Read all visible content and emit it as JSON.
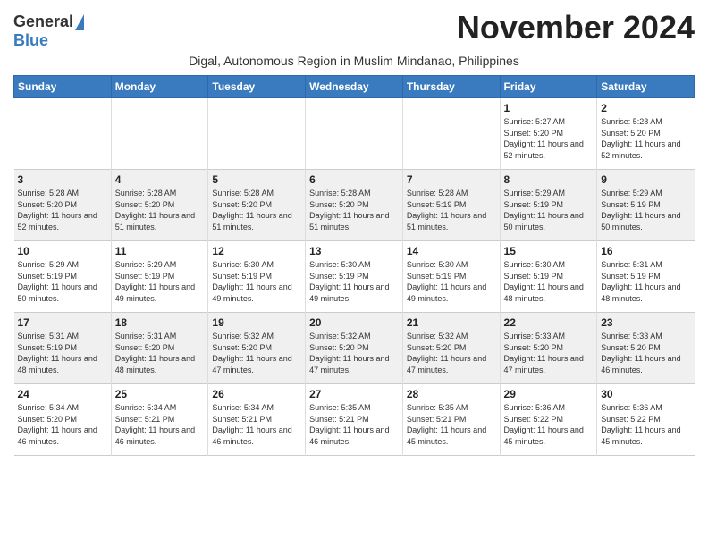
{
  "header": {
    "logo_general": "General",
    "logo_blue": "Blue",
    "month_title": "November 2024",
    "subtitle": "Digal, Autonomous Region in Muslim Mindanao, Philippines"
  },
  "days_of_week": [
    "Sunday",
    "Monday",
    "Tuesday",
    "Wednesday",
    "Thursday",
    "Friday",
    "Saturday"
  ],
  "weeks": [
    [
      {
        "day": "",
        "info": ""
      },
      {
        "day": "",
        "info": ""
      },
      {
        "day": "",
        "info": ""
      },
      {
        "day": "",
        "info": ""
      },
      {
        "day": "",
        "info": ""
      },
      {
        "day": "1",
        "info": "Sunrise: 5:27 AM\nSunset: 5:20 PM\nDaylight: 11 hours and 52 minutes."
      },
      {
        "day": "2",
        "info": "Sunrise: 5:28 AM\nSunset: 5:20 PM\nDaylight: 11 hours and 52 minutes."
      }
    ],
    [
      {
        "day": "3",
        "info": "Sunrise: 5:28 AM\nSunset: 5:20 PM\nDaylight: 11 hours and 52 minutes."
      },
      {
        "day": "4",
        "info": "Sunrise: 5:28 AM\nSunset: 5:20 PM\nDaylight: 11 hours and 51 minutes."
      },
      {
        "day": "5",
        "info": "Sunrise: 5:28 AM\nSunset: 5:20 PM\nDaylight: 11 hours and 51 minutes."
      },
      {
        "day": "6",
        "info": "Sunrise: 5:28 AM\nSunset: 5:20 PM\nDaylight: 11 hours and 51 minutes."
      },
      {
        "day": "7",
        "info": "Sunrise: 5:28 AM\nSunset: 5:19 PM\nDaylight: 11 hours and 51 minutes."
      },
      {
        "day": "8",
        "info": "Sunrise: 5:29 AM\nSunset: 5:19 PM\nDaylight: 11 hours and 50 minutes."
      },
      {
        "day": "9",
        "info": "Sunrise: 5:29 AM\nSunset: 5:19 PM\nDaylight: 11 hours and 50 minutes."
      }
    ],
    [
      {
        "day": "10",
        "info": "Sunrise: 5:29 AM\nSunset: 5:19 PM\nDaylight: 11 hours and 50 minutes."
      },
      {
        "day": "11",
        "info": "Sunrise: 5:29 AM\nSunset: 5:19 PM\nDaylight: 11 hours and 49 minutes."
      },
      {
        "day": "12",
        "info": "Sunrise: 5:30 AM\nSunset: 5:19 PM\nDaylight: 11 hours and 49 minutes."
      },
      {
        "day": "13",
        "info": "Sunrise: 5:30 AM\nSunset: 5:19 PM\nDaylight: 11 hours and 49 minutes."
      },
      {
        "day": "14",
        "info": "Sunrise: 5:30 AM\nSunset: 5:19 PM\nDaylight: 11 hours and 49 minutes."
      },
      {
        "day": "15",
        "info": "Sunrise: 5:30 AM\nSunset: 5:19 PM\nDaylight: 11 hours and 48 minutes."
      },
      {
        "day": "16",
        "info": "Sunrise: 5:31 AM\nSunset: 5:19 PM\nDaylight: 11 hours and 48 minutes."
      }
    ],
    [
      {
        "day": "17",
        "info": "Sunrise: 5:31 AM\nSunset: 5:19 PM\nDaylight: 11 hours and 48 minutes."
      },
      {
        "day": "18",
        "info": "Sunrise: 5:31 AM\nSunset: 5:20 PM\nDaylight: 11 hours and 48 minutes."
      },
      {
        "day": "19",
        "info": "Sunrise: 5:32 AM\nSunset: 5:20 PM\nDaylight: 11 hours and 47 minutes."
      },
      {
        "day": "20",
        "info": "Sunrise: 5:32 AM\nSunset: 5:20 PM\nDaylight: 11 hours and 47 minutes."
      },
      {
        "day": "21",
        "info": "Sunrise: 5:32 AM\nSunset: 5:20 PM\nDaylight: 11 hours and 47 minutes."
      },
      {
        "day": "22",
        "info": "Sunrise: 5:33 AM\nSunset: 5:20 PM\nDaylight: 11 hours and 47 minutes."
      },
      {
        "day": "23",
        "info": "Sunrise: 5:33 AM\nSunset: 5:20 PM\nDaylight: 11 hours and 46 minutes."
      }
    ],
    [
      {
        "day": "24",
        "info": "Sunrise: 5:34 AM\nSunset: 5:20 PM\nDaylight: 11 hours and 46 minutes."
      },
      {
        "day": "25",
        "info": "Sunrise: 5:34 AM\nSunset: 5:21 PM\nDaylight: 11 hours and 46 minutes."
      },
      {
        "day": "26",
        "info": "Sunrise: 5:34 AM\nSunset: 5:21 PM\nDaylight: 11 hours and 46 minutes."
      },
      {
        "day": "27",
        "info": "Sunrise: 5:35 AM\nSunset: 5:21 PM\nDaylight: 11 hours and 46 minutes."
      },
      {
        "day": "28",
        "info": "Sunrise: 5:35 AM\nSunset: 5:21 PM\nDaylight: 11 hours and 45 minutes."
      },
      {
        "day": "29",
        "info": "Sunrise: 5:36 AM\nSunset: 5:22 PM\nDaylight: 11 hours and 45 minutes."
      },
      {
        "day": "30",
        "info": "Sunrise: 5:36 AM\nSunset: 5:22 PM\nDaylight: 11 hours and 45 minutes."
      }
    ]
  ]
}
